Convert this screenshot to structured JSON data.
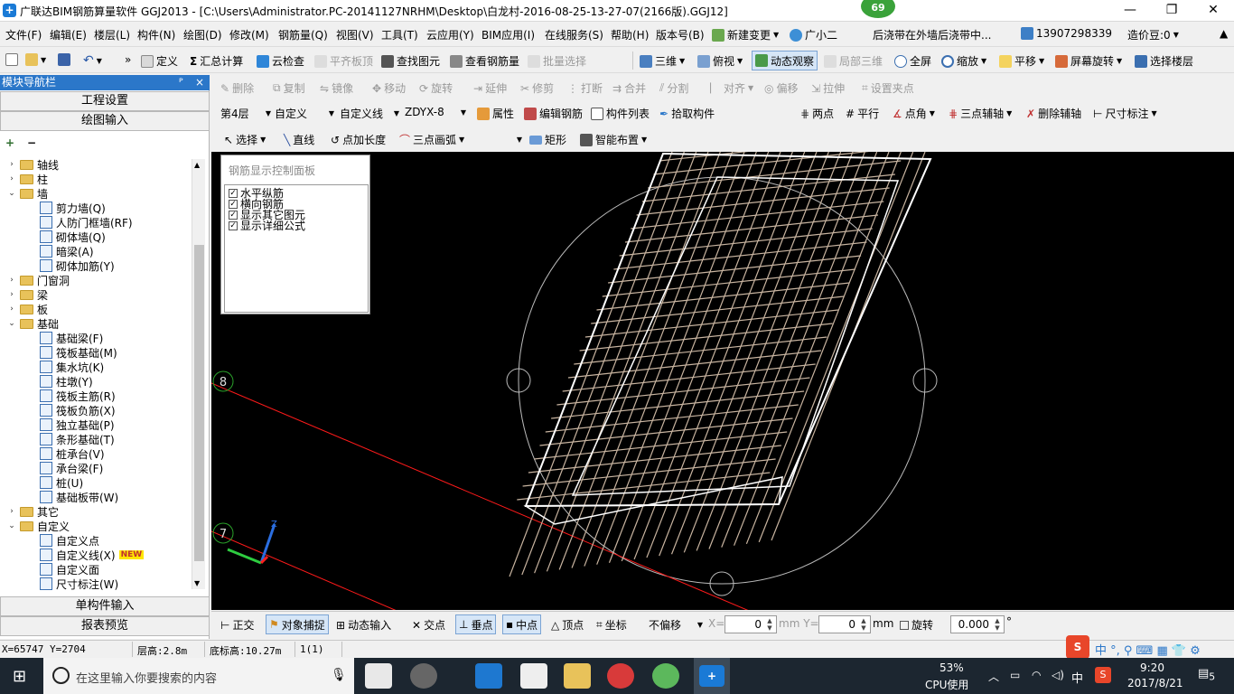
{
  "titlebar": {
    "title": "广联达BIM钢筋算量软件 GGJ2013 - [C:\\Users\\Administrator.PC-20141127NRHM\\Desktop\\白龙村-2016-08-25-13-27-07(2166版).GGJ12]",
    "badge": "69",
    "minimize": "—",
    "restore": "❐",
    "close": "✕"
  },
  "menubar": {
    "items": [
      "文件(F)",
      "编辑(E)",
      "楼层(L)",
      "构件(N)",
      "绘图(D)",
      "修改(M)",
      "钢筋量(Q)",
      "视图(V)",
      "工具(T)",
      "云应用(Y)",
      "BIM应用(I)",
      "在线服务(S)",
      "帮助(H)",
      "版本号(B)"
    ],
    "new_change": "新建变更",
    "guangxiaoer": "广小二",
    "marquee": "后浇带在外墙后浇带中...",
    "phone": "13907298339",
    "price_beans": "造价豆:0"
  },
  "toolbar1": {
    "define": "定义",
    "summary_calc": "汇总计算",
    "cloud_check": "云检查",
    "align_slab_top": "平齐板顶",
    "find_element": "查找图元",
    "view_rebar": "查看钢筋量",
    "batch_select": "批量选择",
    "three_d": "三维",
    "top_view": "俯视",
    "dynamic_view": "动态观察",
    "partial_3d": "局部三维",
    "fullscreen": "全屏",
    "zoom": "缩放",
    "pan": "平移",
    "screen_rotate": "屏幕旋转",
    "select_floor": "选择楼层"
  },
  "toolbar2": {
    "delete": "删除",
    "copy": "复制",
    "mirror": "镜像",
    "move": "移动",
    "rotate": "旋转",
    "extend": "延伸",
    "trim": "修剪",
    "break": "打断",
    "merge": "合并",
    "split": "分割",
    "align": "对齐",
    "offset": "偏移",
    "stretch": "拉伸",
    "set_grip": "设置夹点"
  },
  "toolbar3": {
    "floor": "第4层",
    "category": "自定义",
    "type": "自定义线",
    "component": "ZDYX-8",
    "properties": "属性",
    "edit_rebar": "编辑钢筋",
    "component_list": "构件列表",
    "pick_component": "拾取构件",
    "two_points": "两点",
    "parallel": "平行",
    "point_angle": "点角",
    "three_point_axis": "三点辅轴",
    "delete_axis": "删除辅轴",
    "dimension": "尺寸标注"
  },
  "toolbar4": {
    "select": "选择",
    "line": "直线",
    "point_add_length": "点加长度",
    "three_point_arc": "三点画弧",
    "rectangle": "矩形",
    "smart_layout": "智能布置"
  },
  "nav": {
    "header": "模块导航栏",
    "pin": "ᴾ",
    "close": "×",
    "project_settings": "工程设置",
    "drawing_input": "绘图输入",
    "tree": [
      {
        "label": "轴线",
        "level": 0,
        "folder": true,
        "expand": "›"
      },
      {
        "label": "柱",
        "level": 0,
        "folder": true,
        "expand": "›"
      },
      {
        "label": "墙",
        "level": 0,
        "folder": true,
        "expand": "⌄"
      },
      {
        "label": "剪力墙(Q)",
        "level": 1
      },
      {
        "label": "人防门框墙(RF)",
        "level": 1
      },
      {
        "label": "砌体墙(Q)",
        "level": 1
      },
      {
        "label": "暗梁(A)",
        "level": 1
      },
      {
        "label": "砌体加筋(Y)",
        "level": 1
      },
      {
        "label": "门窗洞",
        "level": 0,
        "folder": true,
        "expand": "›"
      },
      {
        "label": "梁",
        "level": 0,
        "folder": true,
        "expand": "›"
      },
      {
        "label": "板",
        "level": 0,
        "folder": true,
        "expand": "›"
      },
      {
        "label": "基础",
        "level": 0,
        "folder": true,
        "expand": "⌄"
      },
      {
        "label": "基础梁(F)",
        "level": 1
      },
      {
        "label": "筏板基础(M)",
        "level": 1
      },
      {
        "label": "集水坑(K)",
        "level": 1
      },
      {
        "label": "柱墩(Y)",
        "level": 1
      },
      {
        "label": "筏板主筋(R)",
        "level": 1
      },
      {
        "label": "筏板负筋(X)",
        "level": 1
      },
      {
        "label": "独立基础(P)",
        "level": 1
      },
      {
        "label": "条形基础(T)",
        "level": 1
      },
      {
        "label": "桩承台(V)",
        "level": 1
      },
      {
        "label": "承台梁(F)",
        "level": 1
      },
      {
        "label": "桩(U)",
        "level": 1
      },
      {
        "label": "基础板带(W)",
        "level": 1
      },
      {
        "label": "其它",
        "level": 0,
        "folder": true,
        "expand": "›"
      },
      {
        "label": "自定义",
        "level": 0,
        "folder": true,
        "expand": "⌄"
      },
      {
        "label": "自定义点",
        "level": 1
      },
      {
        "label": "自定义线(X)",
        "level": 1,
        "badge": "NEW"
      },
      {
        "label": "自定义面",
        "level": 1
      },
      {
        "label": "尺寸标注(W)",
        "level": 1
      }
    ],
    "single_input": "单构件输入",
    "report_preview": "报表预览"
  },
  "rebar_panel": {
    "title": "钢筋显示控制面板",
    "options": [
      {
        "label": "水平纵筋",
        "checked": true
      },
      {
        "label": "横向钢筋",
        "checked": true
      },
      {
        "label": "显示其它图元",
        "checked": true
      },
      {
        "label": "显示详细公式",
        "checked": true
      }
    ]
  },
  "canvas": {
    "axis_8": "8",
    "axis_7": "7",
    "z_label": "Z"
  },
  "snapbar": {
    "ortho": "正交",
    "object_snap": "对象捕捉",
    "dynamic_input": "动态输入",
    "intersection": "交点",
    "perpendicular": "垂点",
    "midpoint": "中点",
    "vertex": "顶点",
    "coordinate": "坐标",
    "offset_mode": "不偏移",
    "x_label": "X=",
    "x_value": "0",
    "y_label": "mm Y=",
    "y_value": "0",
    "mm": "mm",
    "rotate": "旋转",
    "rotate_value": "0.000",
    "degree": "°"
  },
  "statusbar": {
    "coords": "X=65747 Y=2704",
    "floor_height": "层高:2.8m",
    "bottom_elev": "底标高:10.27m",
    "selection": "1(1)"
  },
  "taskbar": {
    "search_placeholder": "在这里输入你要搜索的内容",
    "cpu_percent": "53%",
    "cpu_label": "CPU使用",
    "ime": "中",
    "time": "9:20",
    "date": "2017/8/21",
    "notifications": "5"
  },
  "colors": {
    "accent": "#2b77c9",
    "canvas_bg": "#000000",
    "rebar": "#c8b4a0",
    "axis_red": "#ff1a1a"
  }
}
